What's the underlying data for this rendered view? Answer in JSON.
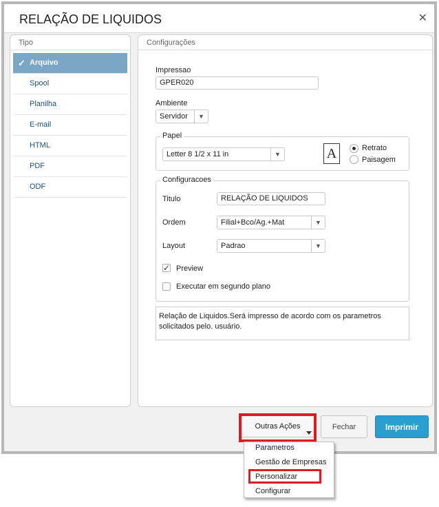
{
  "window": {
    "title": "RELAÇÃO DE LIQUIDOS",
    "close_glyph": "✕"
  },
  "tipo": {
    "header": "Tipo",
    "items": [
      {
        "label": "Arquivo",
        "selected": true
      },
      {
        "label": "Spool"
      },
      {
        "label": "Planilha"
      },
      {
        "label": "E-mail"
      },
      {
        "label": "HTML"
      },
      {
        "label": "PDF"
      },
      {
        "label": "ODF"
      }
    ]
  },
  "config": {
    "header": "Configurações",
    "impressao_label": "Impressao",
    "impressao_value": "GPER020",
    "ambiente_label": "Ambiente",
    "ambiente_value": "Servidor",
    "papel": {
      "legend": "Papel",
      "paper_value": "Letter 8 1/2 x 11 in",
      "doc_icon_glyph": "A",
      "retrato_label": "Retrato",
      "paisagem_label": "Paisagem",
      "orientation": "Retrato"
    },
    "configuracoes": {
      "legend": "Configuracoes",
      "titulo_label": "Titulo",
      "titulo_value": "RELAÇÃO DE LIQUIDOS",
      "ordem_label": "Ordem",
      "ordem_value": "Filial+Bco/Ag.+Mat",
      "layout_label": "Layout",
      "layout_value": "Padrao",
      "preview_label": "Preview",
      "preview_checked": true,
      "segundo_plano_label": "Executar em segundo plano",
      "segundo_plano_checked": false
    },
    "description_line1": "Relação de Liquidos.Será impresso de acordo com os parametros",
    "description_line2": "solicitados pelo. usuário."
  },
  "footer": {
    "outras_acoes": "Outras Ações",
    "fechar": "Fechar",
    "imprimir": "Imprimir"
  },
  "menu": {
    "items": [
      "Parametros",
      "Gestão de Empresas",
      "Personalizar",
      "Configurar"
    ]
  },
  "colors": {
    "highlight": "#e01a22",
    "primary_button": "#2a9fcf",
    "selected_tipo": "#7aa7c6"
  }
}
